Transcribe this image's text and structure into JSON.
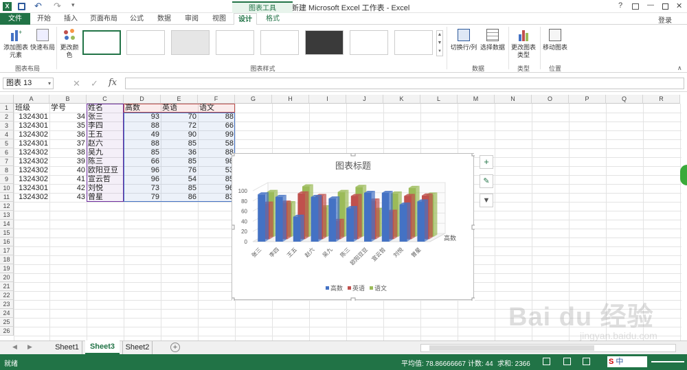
{
  "titlebar": {
    "title": "新建 Microsoft Excel 工作表 - Excel",
    "context_tab": "图表工具",
    "login": "登录",
    "help": "?",
    "minimize": "—",
    "close": "✕"
  },
  "tabs": [
    "文件",
    "开始",
    "插入",
    "页面布局",
    "公式",
    "数据",
    "审阅",
    "视图",
    "设计",
    "格式"
  ],
  "ribbon": {
    "add_element": "添加图表元素",
    "quick_layout": "快速布局",
    "change_colors": "更改颜色",
    "group_layout": "图表布局",
    "group_styles": "图表样式",
    "switch_rowcol": "切换行/列",
    "select_data": "选择数据",
    "group_data": "数据",
    "change_type": "更改图表类型",
    "group_type": "类型",
    "move_chart": "移动图表",
    "group_location": "位置"
  },
  "formula": {
    "namebox": "图表 13",
    "fx": "fx",
    "cancel": "✕",
    "enter": "✓"
  },
  "columns": [
    "A",
    "B",
    "C",
    "D",
    "E",
    "F",
    "G",
    "H",
    "I",
    "J",
    "K",
    "L",
    "M",
    "N",
    "O",
    "P",
    "Q",
    "R"
  ],
  "rows": [
    "1",
    "2",
    "3",
    "4",
    "5",
    "6",
    "7",
    "8",
    "9",
    "10",
    "11",
    "12",
    "13",
    "14",
    "15",
    "16",
    "17",
    "18",
    "19",
    "20",
    "21",
    "22",
    "23",
    "24",
    "25",
    "26"
  ],
  "table": {
    "headers": [
      "班级",
      "学号",
      "姓名",
      "高数",
      "英语",
      "语文"
    ],
    "records": [
      [
        "1324301",
        "34",
        "张三",
        "93",
        "70",
        "88"
      ],
      [
        "1324301",
        "35",
        "李四",
        "88",
        "72",
        "66"
      ],
      [
        "1324302",
        "36",
        "王五",
        "49",
        "90",
        "99"
      ],
      [
        "1324301",
        "37",
        "赵六",
        "88",
        "85",
        "58"
      ],
      [
        "1324302",
        "38",
        "吴九",
        "85",
        "36",
        "88"
      ],
      [
        "1324302",
        "39",
        "陈三",
        "66",
        "85",
        "98"
      ],
      [
        "1324302",
        "40",
        "欧阳豆豆",
        "96",
        "76",
        "53"
      ],
      [
        "1324302",
        "41",
        "宣云哲",
        "96",
        "54",
        "85"
      ],
      [
        "1324301",
        "42",
        "刘悦",
        "73",
        "85",
        "96"
      ],
      [
        "1324302",
        "43",
        "曾星",
        "79",
        "86",
        "83"
      ]
    ]
  },
  "chart_data": {
    "type": "bar",
    "title": "图表标题",
    "categories": [
      "张三",
      "李四",
      "王五",
      "赵六",
      "吴九",
      "陈三",
      "欧阳豆豆",
      "宣云哲",
      "刘悦",
      "曾星"
    ],
    "series": [
      {
        "name": "高数",
        "values": [
          93,
          88,
          49,
          88,
          85,
          66,
          96,
          96,
          73,
          79
        ]
      },
      {
        "name": "英语",
        "values": [
          70,
          72,
          90,
          85,
          36,
          85,
          76,
          54,
          85,
          86
        ]
      },
      {
        "name": "语文",
        "values": [
          88,
          66,
          99,
          58,
          88,
          98,
          53,
          85,
          96,
          83
        ]
      }
    ],
    "yticks": [
      "0",
      "20",
      "40",
      "60",
      "80",
      "100"
    ],
    "ylim": [
      0,
      100
    ],
    "depth_label": "高数",
    "legend": "bottom",
    "colors": [
      "#4472c4",
      "#c0504d",
      "#9bbb59"
    ]
  },
  "sheets": [
    "Sheet1",
    "Sheet3",
    "Sheet2"
  ],
  "active_sheet": "Sheet3",
  "status": {
    "ready": "就绪",
    "average": "平均值: 78.86666667",
    "count": "计数: 44",
    "sum": "求和: 2366"
  },
  "watermark": "Bai du 经验",
  "watermark_url": "jingyan.baidu.com",
  "ime": "中"
}
